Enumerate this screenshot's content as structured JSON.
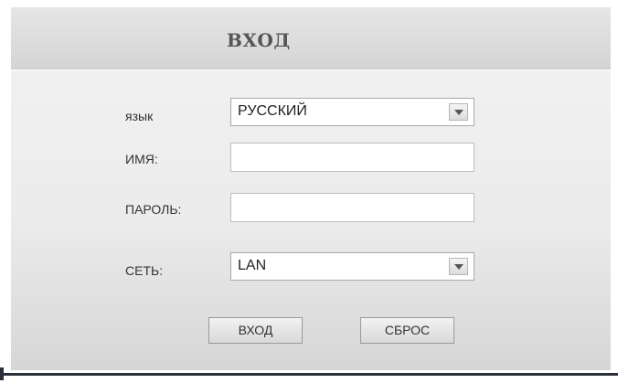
{
  "dialog": {
    "title": "ВХОД"
  },
  "form": {
    "language_label": "язык",
    "language_value": "РУССКИЙ",
    "name_label": "ИМЯ:",
    "name_value": "",
    "password_label": "ПАРОЛЬ:",
    "password_value": "",
    "network_label": "СЕТЬ:",
    "network_value": "LAN"
  },
  "buttons": {
    "login_label": "ВХОД",
    "reset_label": "СБРОС"
  }
}
